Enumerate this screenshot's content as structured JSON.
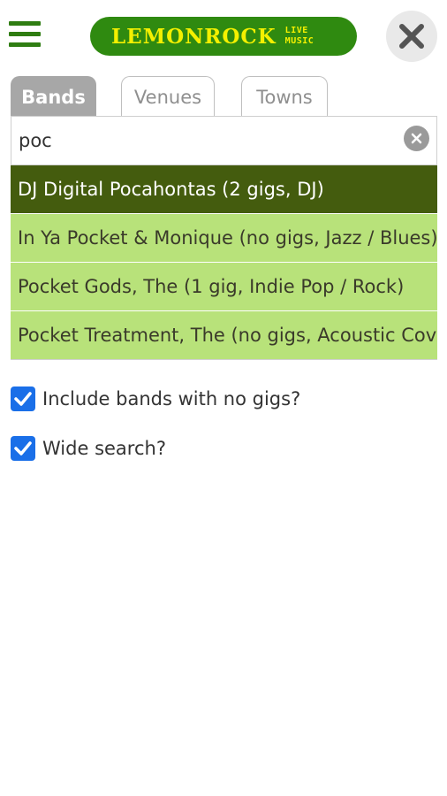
{
  "header": {
    "logo_main": "LEMONROCK",
    "logo_sub_1": "LIVE",
    "logo_sub_2": "MUSIC"
  },
  "tabs": [
    {
      "label": "Bands",
      "active": true
    },
    {
      "label": "Venues",
      "active": false
    },
    {
      "label": "Towns",
      "active": false
    }
  ],
  "search": {
    "value": "poc",
    "placeholder": ""
  },
  "results": [
    {
      "label": "DJ Digital Pocahontas (2 gigs, DJ)",
      "selected": true
    },
    {
      "label": "In Ya Pocket & Monique (no gigs, Jazz / Blues)",
      "selected": false
    },
    {
      "label": "Pocket Gods, The (1 gig, Indie Pop / Rock)",
      "selected": false
    },
    {
      "label": "Pocket Treatment, The (no gigs, Acoustic Cover Band)",
      "selected": false
    }
  ],
  "options": {
    "include_no_gigs_label": "Include bands with no gigs?",
    "include_no_gigs_checked": true,
    "wide_search_label": "Wide search?",
    "wide_search_checked": true
  },
  "colors": {
    "brand_green": "#2f8a10",
    "logo_yellow": "#f4f000",
    "result_bg": "#b8e27a",
    "result_selected_bg": "#445c0e",
    "checkbox_blue": "#1a6fe8"
  },
  "icons": {
    "menu": "hamburger-icon",
    "close": "close-icon",
    "clear": "clear-search-icon",
    "check": "checkmark-icon"
  }
}
